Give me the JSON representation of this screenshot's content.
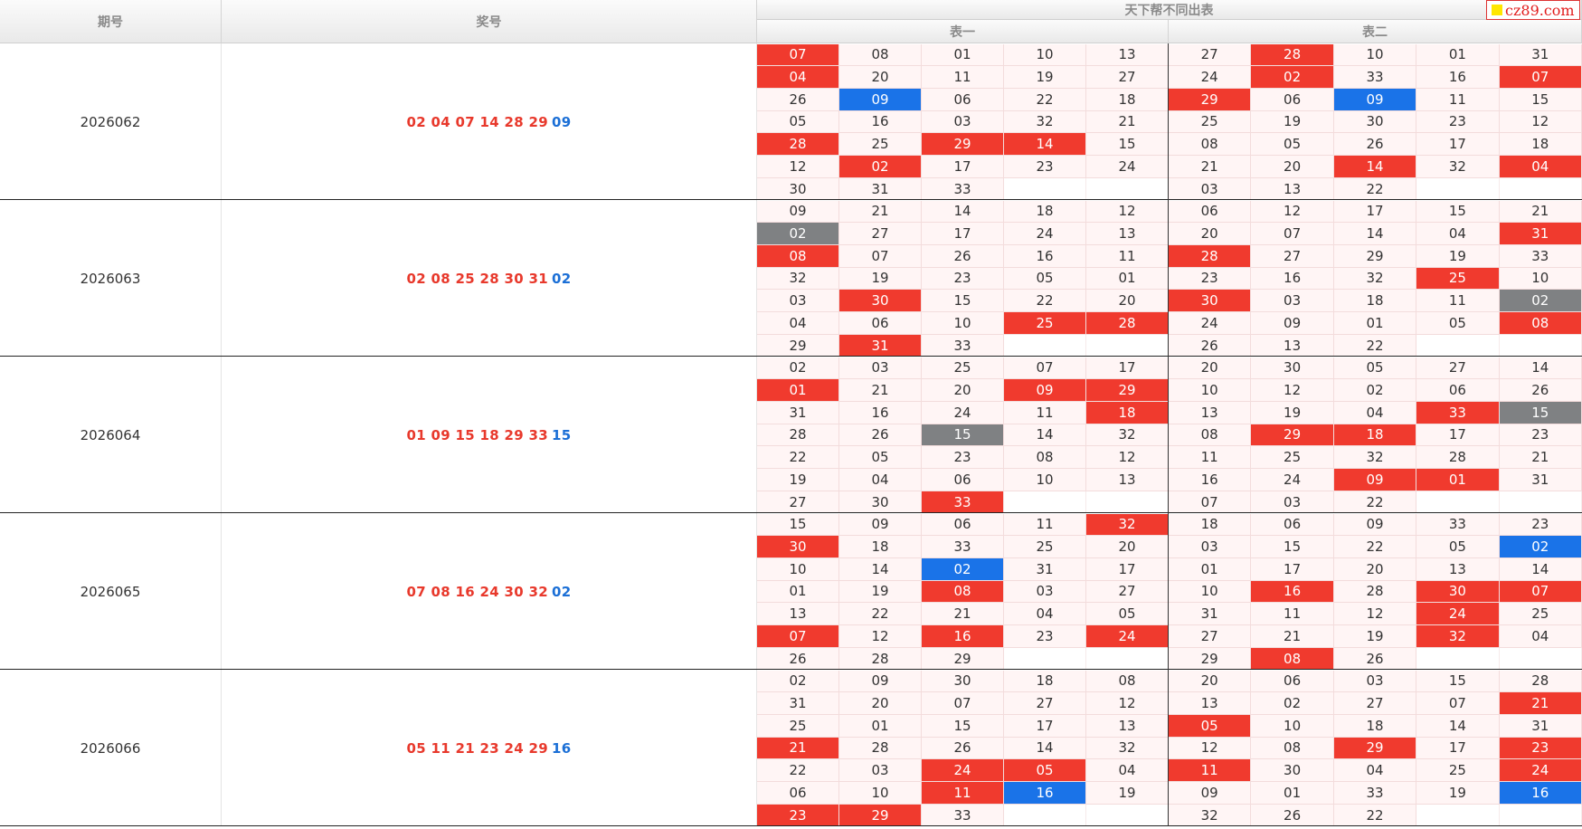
{
  "header": {
    "issue_label": "期号",
    "draw_label": "奖号",
    "group_title": "天下帮不同出表",
    "table1_label": "表一",
    "table2_label": "表二"
  },
  "logo_text": "cz89.com",
  "colors": {
    "red": "#f03a2e",
    "blue": "#1a73e8",
    "gray": "#7f8183",
    "cell_bg": "#fff5f5"
  },
  "rows": [
    {
      "issue": "2026062",
      "reds": [
        "02",
        "04",
        "07",
        "14",
        "28",
        "29"
      ],
      "blue": "09",
      "t1": [
        [
          "07R",
          "08",
          "01",
          "10",
          "13"
        ],
        [
          "04R",
          "20",
          "11",
          "19",
          "27"
        ],
        [
          "26",
          "09B",
          "06",
          "22",
          "18"
        ],
        [
          "05",
          "16",
          "03",
          "32",
          "21"
        ],
        [
          "28R",
          "25",
          "29R",
          "14R",
          "15"
        ],
        [
          "12",
          "02R",
          "17",
          "23",
          "24"
        ],
        [
          "30",
          "31",
          "33",
          "",
          ""
        ]
      ],
      "t2": [
        [
          "27",
          "28R",
          "10",
          "01",
          "31"
        ],
        [
          "24",
          "02R",
          "33",
          "16",
          "07R"
        ],
        [
          "29R",
          "06",
          "09B",
          "11",
          "15"
        ],
        [
          "25",
          "19",
          "30",
          "23",
          "12"
        ],
        [
          "08",
          "05",
          "26",
          "17",
          "18"
        ],
        [
          "21",
          "20",
          "14R",
          "32",
          "04R"
        ],
        [
          "03",
          "13",
          "22",
          "",
          ""
        ]
      ]
    },
    {
      "issue": "2026063",
      "reds": [
        "02",
        "08",
        "25",
        "28",
        "30",
        "31"
      ],
      "blue": "02",
      "t1": [
        [
          "09",
          "21",
          "14",
          "18",
          "12"
        ],
        [
          "02G",
          "27",
          "17",
          "24",
          "13"
        ],
        [
          "08R",
          "07",
          "26",
          "16",
          "11"
        ],
        [
          "32",
          "19",
          "23",
          "05",
          "01"
        ],
        [
          "03",
          "30R",
          "15",
          "22",
          "20"
        ],
        [
          "04",
          "06",
          "10",
          "25R",
          "28R"
        ],
        [
          "29",
          "31R",
          "33",
          "",
          ""
        ]
      ],
      "t2": [
        [
          "06",
          "12",
          "17",
          "15",
          "21"
        ],
        [
          "20",
          "07",
          "14",
          "04",
          "31R"
        ],
        [
          "28R",
          "27",
          "29",
          "19",
          "33"
        ],
        [
          "23",
          "16",
          "32",
          "25R",
          "10"
        ],
        [
          "30R",
          "03",
          "18",
          "11",
          "02G"
        ],
        [
          "24",
          "09",
          "01",
          "05",
          "08R"
        ],
        [
          "26",
          "13",
          "22",
          "",
          ""
        ]
      ]
    },
    {
      "issue": "2026064",
      "reds": [
        "01",
        "09",
        "15",
        "18",
        "29",
        "33"
      ],
      "blue": "15",
      "t1": [
        [
          "02",
          "03",
          "25",
          "07",
          "17"
        ],
        [
          "01R",
          "21",
          "20",
          "09R",
          "29R"
        ],
        [
          "31",
          "16",
          "24",
          "11",
          "18R"
        ],
        [
          "28",
          "26",
          "15G",
          "14",
          "32"
        ],
        [
          "22",
          "05",
          "23",
          "08",
          "12"
        ],
        [
          "19",
          "04",
          "06",
          "10",
          "13"
        ],
        [
          "27",
          "30",
          "33R",
          "",
          ""
        ]
      ],
      "t2": [
        [
          "20",
          "30",
          "05",
          "27",
          "14"
        ],
        [
          "10",
          "12",
          "02",
          "06",
          "26"
        ],
        [
          "13",
          "19",
          "04",
          "33R",
          "15G"
        ],
        [
          "08",
          "29R",
          "18R",
          "17",
          "23"
        ],
        [
          "11",
          "25",
          "32",
          "28",
          "21"
        ],
        [
          "16",
          "24",
          "09R",
          "01R",
          "31"
        ],
        [
          "07",
          "03",
          "22",
          "",
          ""
        ]
      ]
    },
    {
      "issue": "2026065",
      "reds": [
        "07",
        "08",
        "16",
        "24",
        "30",
        "32"
      ],
      "blue": "02",
      "t1": [
        [
          "15",
          "09",
          "06",
          "11",
          "32R"
        ],
        [
          "30R",
          "18",
          "33",
          "25",
          "20"
        ],
        [
          "10",
          "14",
          "02B",
          "31",
          "17"
        ],
        [
          "01",
          "19",
          "08R",
          "03",
          "27"
        ],
        [
          "13",
          "22",
          "21",
          "04",
          "05"
        ],
        [
          "07R",
          "12",
          "16R",
          "23",
          "24R"
        ],
        [
          "26",
          "28",
          "29",
          "",
          ""
        ]
      ],
      "t2": [
        [
          "18",
          "06",
          "09",
          "33",
          "23"
        ],
        [
          "03",
          "15",
          "22",
          "05",
          "02B"
        ],
        [
          "01",
          "17",
          "20",
          "13",
          "14"
        ],
        [
          "10",
          "16R",
          "28",
          "30R",
          "07R"
        ],
        [
          "31",
          "11",
          "12",
          "24R",
          "25"
        ],
        [
          "27",
          "21",
          "19",
          "32R",
          "04"
        ],
        [
          "29",
          "08R",
          "26",
          "",
          ""
        ]
      ]
    },
    {
      "issue": "2026066",
      "reds": [
        "05",
        "11",
        "21",
        "23",
        "24",
        "29"
      ],
      "blue": "16",
      "t1": [
        [
          "02",
          "09",
          "30",
          "18",
          "08"
        ],
        [
          "31",
          "20",
          "07",
          "27",
          "12"
        ],
        [
          "25",
          "01",
          "15",
          "17",
          "13"
        ],
        [
          "21R",
          "28",
          "26",
          "14",
          "32"
        ],
        [
          "22",
          "03",
          "24R",
          "05R",
          "04"
        ],
        [
          "06",
          "10",
          "11R",
          "16B",
          "19"
        ],
        [
          "23R",
          "29R",
          "33",
          "",
          ""
        ]
      ],
      "t2": [
        [
          "20",
          "06",
          "03",
          "15",
          "28"
        ],
        [
          "13",
          "02",
          "27",
          "07",
          "21R"
        ],
        [
          "05R",
          "10",
          "18",
          "14",
          "31"
        ],
        [
          "12",
          "08",
          "29R",
          "17",
          "23R"
        ],
        [
          "11R",
          "30",
          "04",
          "25",
          "24R"
        ],
        [
          "09",
          "01",
          "33",
          "19",
          "16B"
        ],
        [
          "32",
          "26",
          "22",
          "",
          ""
        ]
      ]
    }
  ]
}
